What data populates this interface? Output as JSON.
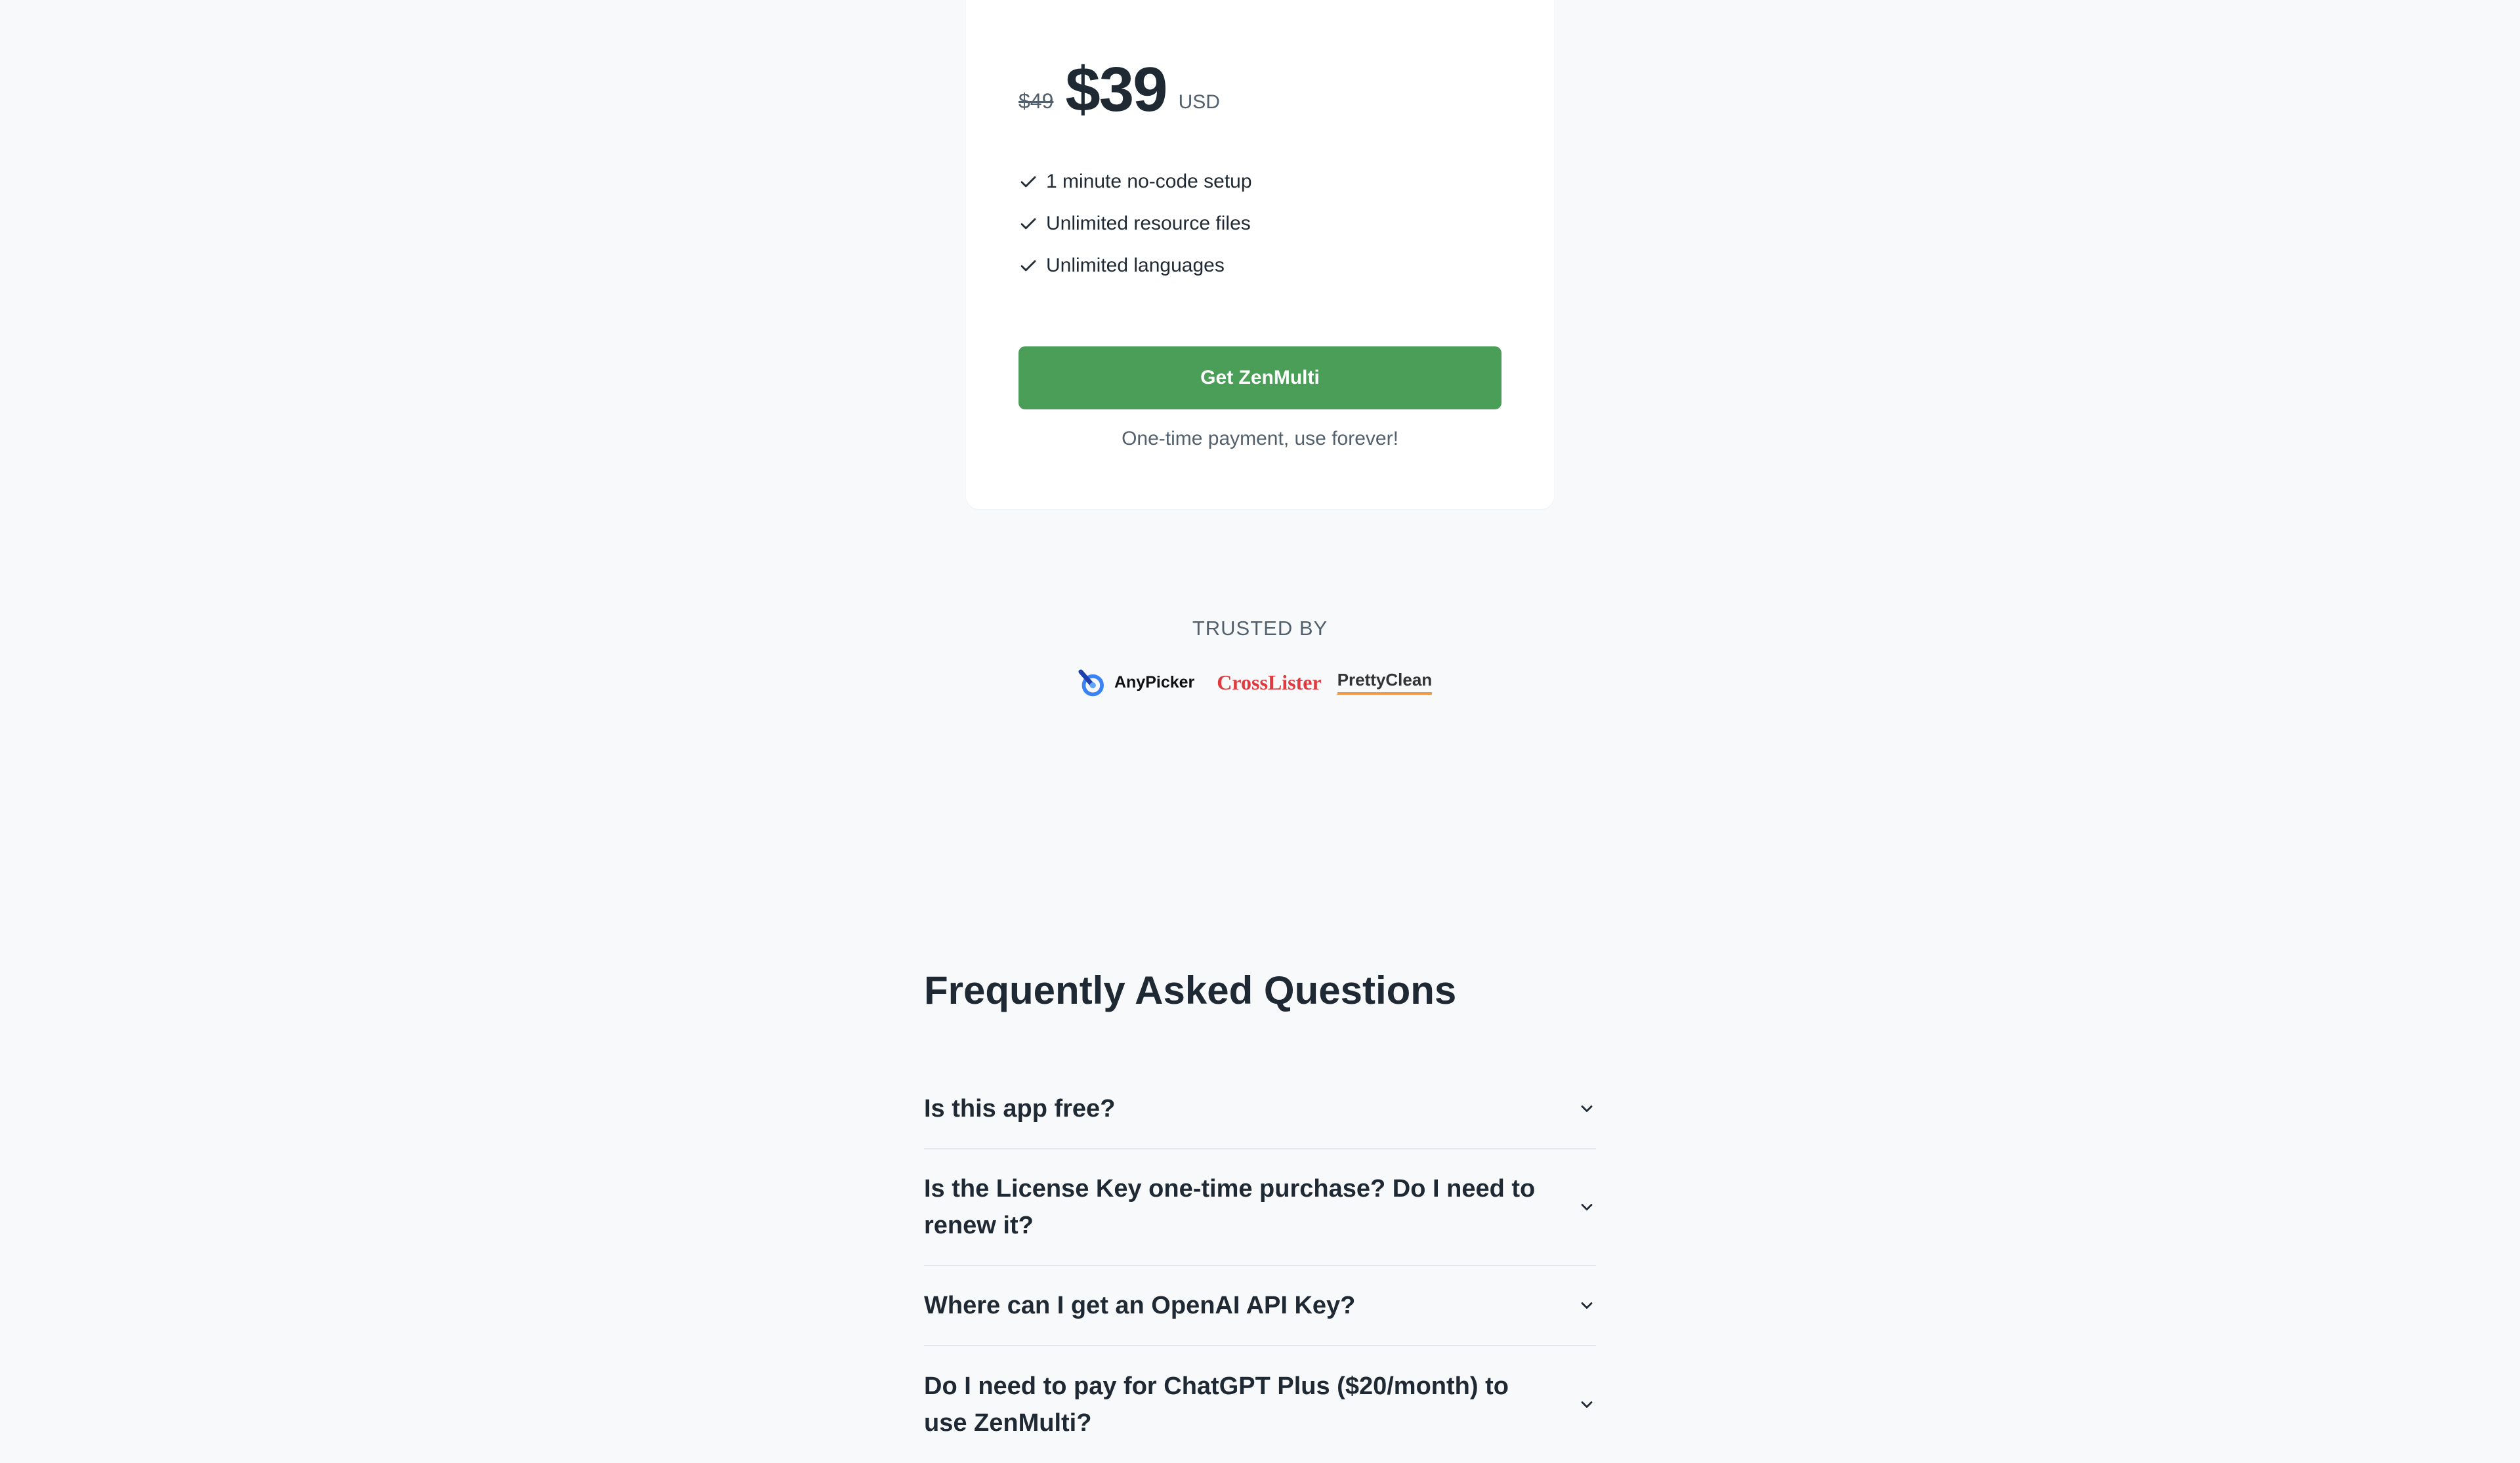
{
  "pricing": {
    "old_price": "$49",
    "price": "$39",
    "currency": "USD",
    "features": [
      "1 minute no-code setup",
      "Unlimited resource files",
      "Unlimited languages"
    ],
    "cta_label": "Get ZenMulti",
    "cta_note": "One-time payment, use forever!",
    "accent_color": "#4a9e57"
  },
  "trusted": {
    "label": "TRUSTED BY",
    "logos": [
      "AnyPicker",
      "CrossLister",
      "PrettyClean"
    ]
  },
  "faq": {
    "title": "Frequently Asked Questions",
    "items": [
      "Is this app free?",
      "Is the License Key one-time purchase? Do I need to renew it?",
      "Where can I get an OpenAI API Key?",
      "Do I need to pay for ChatGPT Plus ($20/month) to use ZenMulti?"
    ],
    "icons": {
      "check": "check-icon",
      "chevron": "chevron-down-icon"
    }
  }
}
